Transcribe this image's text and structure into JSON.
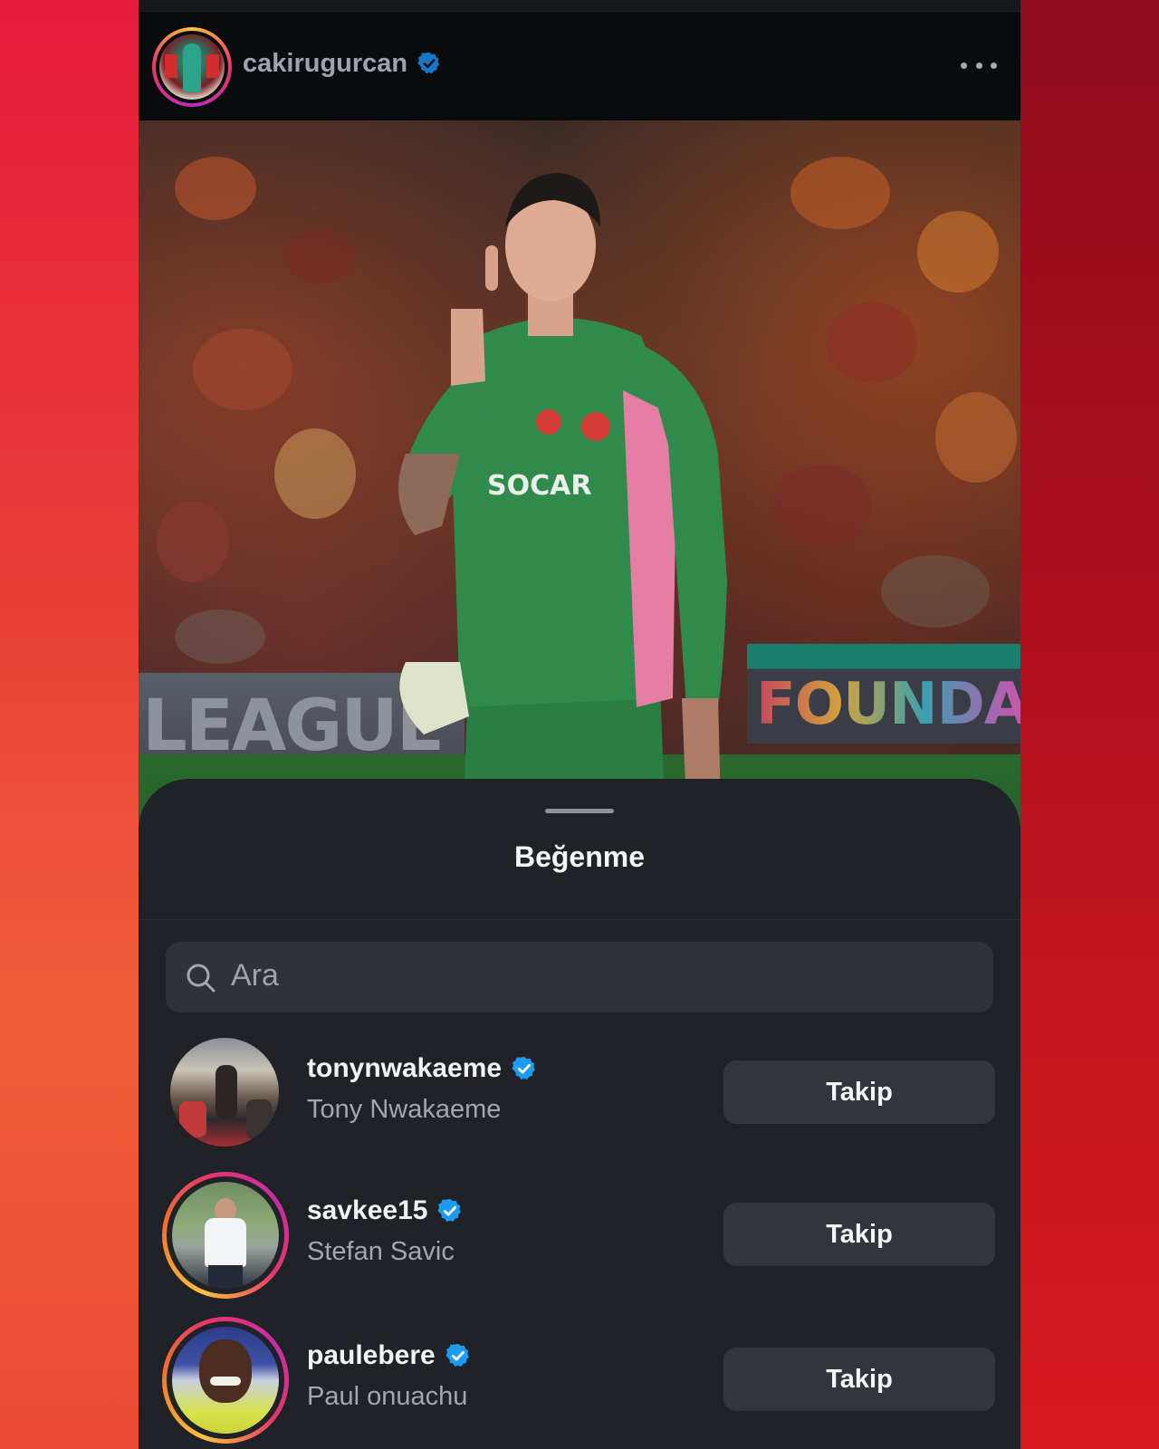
{
  "post": {
    "username": "cakirugurcan",
    "verified": true,
    "more_icon": "more-horizontal-icon",
    "image_text_left": "LEAGUE",
    "image_text_right": "FOUNDATION",
    "jersey_sponsor": "SOCAR"
  },
  "likes_sheet": {
    "title": "Beğenme",
    "search": {
      "placeholder": "Ara",
      "icon": "search-icon"
    },
    "users": [
      {
        "username": "tonynwakaeme",
        "full_name": "Tony Nwakaeme",
        "verified": true,
        "story_ring": false,
        "button": "Takip"
      },
      {
        "username": "savkee15",
        "full_name": "Stefan Savic",
        "verified": true,
        "story_ring": true,
        "button": "Takip"
      },
      {
        "username": "paulebere",
        "full_name": "Paul onuachu",
        "verified": true,
        "story_ring": true,
        "button": "Takip"
      }
    ]
  },
  "colors": {
    "verified_badge": "#1d9bf0",
    "sheet_bg": "#202227",
    "button_bg": "#32353c"
  }
}
